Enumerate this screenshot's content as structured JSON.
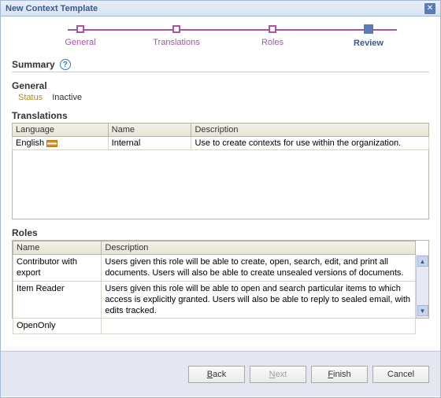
{
  "title": "New Context Template",
  "steps": {
    "s1": "General",
    "s2": "Translations",
    "s3": "Roles",
    "s4": "Review"
  },
  "summary_label": "Summary",
  "general": {
    "heading": "General",
    "status_label": "Status",
    "status_value": "Inactive"
  },
  "translations": {
    "heading": "Translations",
    "cols": {
      "c1": "Language",
      "c2": "Name",
      "c3": "Description"
    },
    "rows": [
      {
        "lang": "English",
        "name": "Internal",
        "desc": "Use to create contexts for use within the organization."
      }
    ]
  },
  "roles": {
    "heading": "Roles",
    "cols": {
      "c1": "Name",
      "c2": "Description"
    },
    "rows": [
      {
        "name": "Contributor with export",
        "desc": "Users given this role will be able to create, open, search, edit, and print all documents. Users will also be able to create unsealed versions of documents."
      },
      {
        "name": "Item Reader",
        "desc": "Users given this role will be able to open and search particular items to which access is explicitly granted. Users will also be able to reply to sealed email, with edits tracked."
      },
      {
        "name": "OpenOnly",
        "desc": ""
      }
    ]
  },
  "buttons": {
    "back": "Back",
    "next": "Next",
    "finish": "Finish",
    "cancel": "Cancel"
  }
}
